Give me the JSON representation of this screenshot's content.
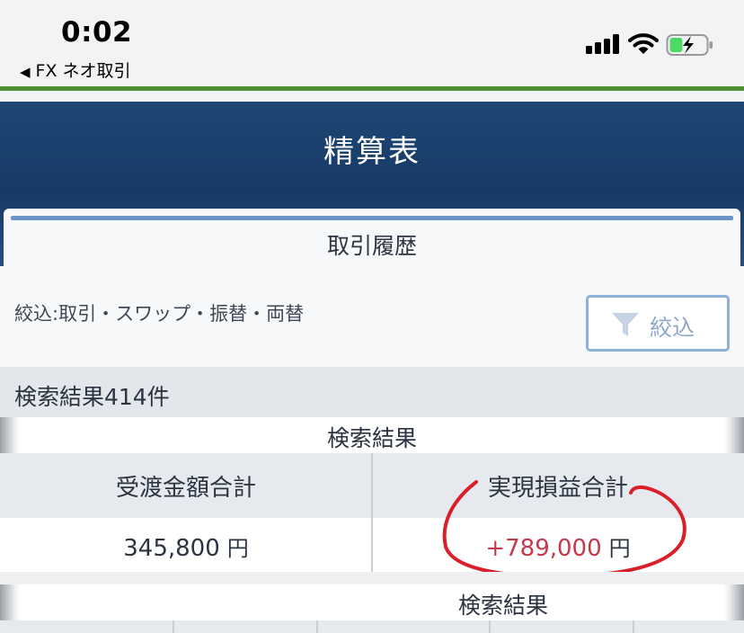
{
  "status_bar": {
    "time": "0:02",
    "back_app": "FX ネオ取引"
  },
  "header": {
    "title": "精算表"
  },
  "tab": {
    "label": "取引履歴"
  },
  "filter": {
    "description": "絞込:取引・スワップ・振替・両替",
    "button_label": "絞込"
  },
  "results": {
    "count_label": "検索結果414件",
    "section_title": "検索結果",
    "columns": [
      "受渡金額合計",
      "実現損益合計"
    ],
    "delivery_total": "345,800",
    "realized_pl_total": "+789,000",
    "unit": "円",
    "section_title_2": "検索結果"
  },
  "colors": {
    "header_bg": "#1e4674",
    "accent_green": "#4e8f35",
    "profit_red": "#c4394c",
    "filter_button_border": "#8fb0d8",
    "annotation_red": "#d9202a"
  },
  "icons": {
    "back": "back-triangle-icon",
    "signal": "cellular-signal-icon",
    "wifi": "wifi-icon",
    "battery": "battery-charging-icon",
    "filter": "funnel-icon"
  }
}
